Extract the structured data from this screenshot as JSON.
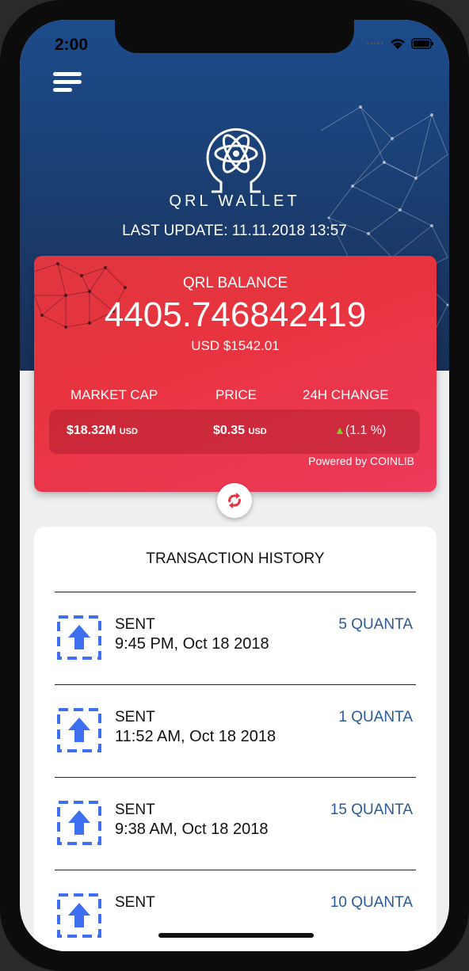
{
  "status_bar": {
    "time": "2:00"
  },
  "header": {
    "app_name": "QRL WALLET",
    "last_update": "LAST UPDATE: 11.11.2018 13:57",
    "logo_icon": "qrl-atom-omega-logo"
  },
  "balance": {
    "label": "QRL BALANCE",
    "amount": "4405.746842419",
    "usd": "USD $1542.01"
  },
  "stats": {
    "market_cap_label": "MARKET CAP",
    "price_label": "PRICE",
    "change_label": "24H CHANGE",
    "market_cap_value": "$18.32M",
    "market_cap_unit": "USD",
    "price_value": "$0.35",
    "price_unit": "USD",
    "change_value": "(1.1 %)",
    "change_direction": "up",
    "change_color": "#7ed321",
    "powered_by": "Powered by COINLIB"
  },
  "transactions": {
    "title": "TRANSACTION HISTORY",
    "items": [
      {
        "type": "SENT",
        "date": "9:45 PM, Oct 18 2018",
        "amount": "5 QUANTA"
      },
      {
        "type": "SENT",
        "date": "11:52 AM, Oct 18 2018",
        "amount": "1 QUANTA"
      },
      {
        "type": "SENT",
        "date": "9:38 AM, Oct 18 2018",
        "amount": "15 QUANTA"
      },
      {
        "type": "SENT",
        "date": "",
        "amount": "10 QUANTA"
      }
    ]
  },
  "colors": {
    "header_blue": "#1b3f73",
    "card_red": "#e8343f",
    "amount_blue": "#2b5a99",
    "icon_blue": "#3d6ff0"
  }
}
